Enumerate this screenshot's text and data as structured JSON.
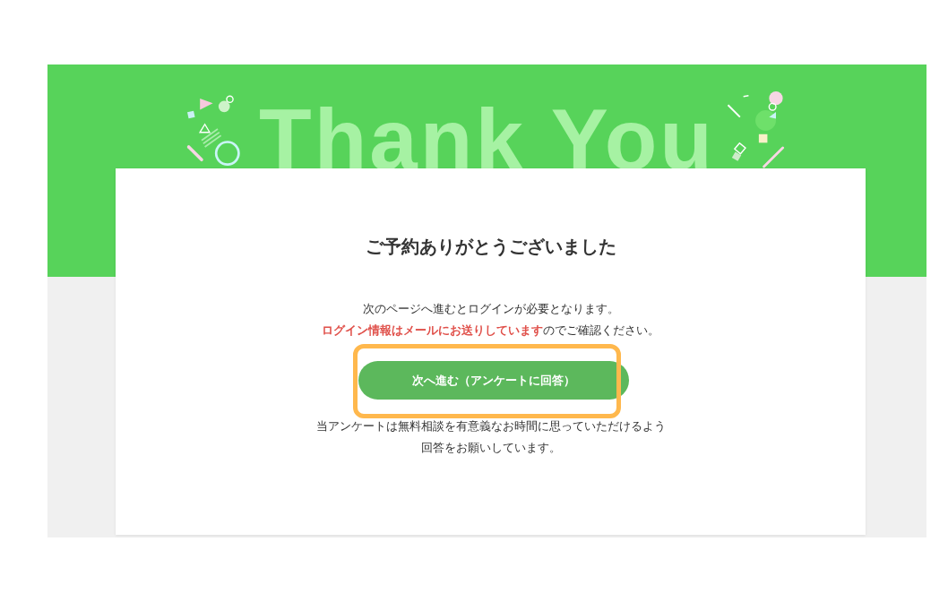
{
  "banner": {
    "heading": "Thank You"
  },
  "card": {
    "title": "ご予約ありがとうございました",
    "message": [
      "次のページへ進むとログインが必要となります。",
      "**ログイン情報はメールにお送りしています**のでご確認ください。"
    ],
    "button": {
      "label": "次へ進む（アンケートに回答）",
      "highlighted": true
    },
    "note": [
      "当アンケートは無料相談を有意義なお時間に思っていただけるよう",
      "回答をお願いしています。"
    ]
  }
}
